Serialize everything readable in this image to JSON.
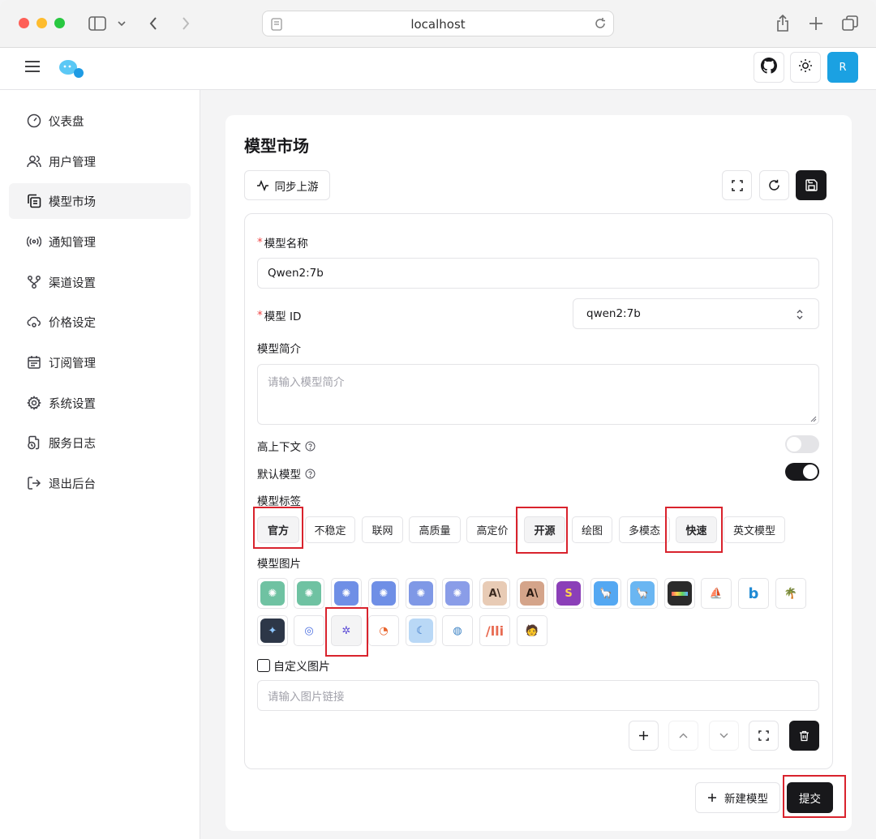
{
  "browser": {
    "url": "localhost"
  },
  "header": {
    "avatar_initial": "R"
  },
  "sidebar": {
    "items": [
      {
        "label": "仪表盘",
        "icon": "gauge-icon"
      },
      {
        "label": "用户管理",
        "icon": "users-icon"
      },
      {
        "label": "模型市场",
        "icon": "copy-icon",
        "active": true
      },
      {
        "label": "通知管理",
        "icon": "broadcast-icon"
      },
      {
        "label": "渠道设置",
        "icon": "git-branch-icon"
      },
      {
        "label": "价格设定",
        "icon": "cloud-cog-icon"
      },
      {
        "label": "订阅管理",
        "icon": "calendar-icon"
      },
      {
        "label": "系统设置",
        "icon": "gear-icon"
      },
      {
        "label": "服务日志",
        "icon": "file-clock-icon"
      },
      {
        "label": "退出后台",
        "icon": "logout-icon"
      }
    ]
  },
  "main": {
    "title": "模型市场",
    "sync_label": "同步上游",
    "form": {
      "name_label": "模型名称",
      "name_value": "Qwen2:7b",
      "id_label": "模型 ID",
      "id_value": "qwen2:7b",
      "desc_label": "模型简介",
      "desc_placeholder": "请输入模型简介",
      "high_context_label": "高上下文",
      "high_context_on": false,
      "default_label": "默认模型",
      "default_on": true,
      "tags_label": "模型标签",
      "tags": [
        {
          "label": "官方",
          "selected": true
        },
        {
          "label": "不稳定",
          "selected": false
        },
        {
          "label": "联网",
          "selected": false
        },
        {
          "label": "高质量",
          "selected": false
        },
        {
          "label": "高定价",
          "selected": false
        },
        {
          "label": "开源",
          "selected": true
        },
        {
          "label": "绘图",
          "selected": false
        },
        {
          "label": "多模态",
          "selected": false
        },
        {
          "label": "快速",
          "selected": true
        },
        {
          "label": "英文模型",
          "selected": false
        }
      ],
      "images_label": "模型图片",
      "custom_image_label": "自定义图片",
      "image_url_placeholder": "请输入图片链接"
    },
    "new_model_label": "新建模型",
    "submit_label": "提交"
  },
  "colors": {
    "accent": "#18181b",
    "highlight_box": "#d9232d",
    "avatar": "#1ba1e2"
  }
}
